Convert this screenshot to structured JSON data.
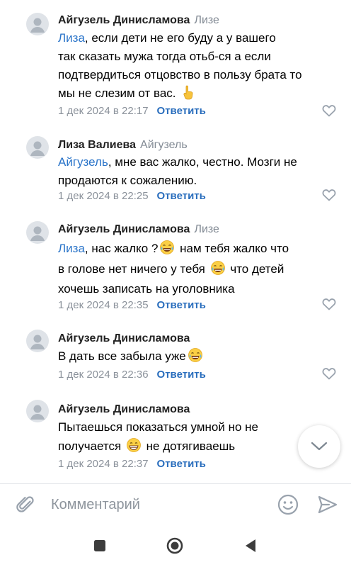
{
  "comments": [
    {
      "author": "Айгузель Динисламова",
      "reply_to": "Лизе",
      "lines": [
        {
          "mention": "Лиза",
          "text": ", если дети не его буду  а у вашего"
        },
        {
          "text": "так сказать мужа тогда отьб-ся  а если"
        },
        {
          "text": "подтвердиться отцовство в пользу брата то"
        },
        {
          "text": "мы не слезим от вас. ",
          "emoji": "pointing-up-emoji"
        }
      ],
      "time": "1 дек 2024 в 22:17",
      "reply_label": "Ответить"
    },
    {
      "author": "Лиза Валиева",
      "reply_to": "Айгузель",
      "lines": [
        {
          "mention": "Айгузель",
          "text": ", мне вас жалко, честно. Мозги не"
        },
        {
          "text": "продаются к сожалению."
        }
      ],
      "time": "1 дек 2024 в 22:25",
      "reply_label": "Ответить"
    },
    {
      "author": "Айгузель Динисламова",
      "reply_to": "Лизе",
      "lines": [
        {
          "mention": "Лиза",
          "text": ", нас жалко ?",
          "emoji": "tears-of-joy-emoji",
          "after": "  нам тебя жалко что"
        },
        {
          "text": "в голове нет ничего у тебя ",
          "emoji": "tears-of-joy-emoji",
          "after": " что детей"
        },
        {
          "text": "хочешь записать на уголовника"
        }
      ],
      "time": "1 дек 2024 в 22:35",
      "reply_label": "Ответить"
    },
    {
      "author": "Айгузель Динисламова",
      "reply_to": "",
      "lines": [
        {
          "text": "В дать все забыла уже",
          "emoji": "tears-of-joy-emoji"
        }
      ],
      "time": "1 дек 2024 в 22:36",
      "reply_label": "Ответить"
    },
    {
      "author": "Айгузель Динисламова",
      "reply_to": "",
      "lines": [
        {
          "text": "Пытаешься показаться умной но не"
        },
        {
          "text": "получается ",
          "emoji": "grinning-emoji",
          "after": " не дотягиваешь"
        }
      ],
      "time": "1 дек 2024 в 22:37",
      "reply_label": "Ответить"
    }
  ],
  "composer": {
    "placeholder": "Комментарий"
  },
  "icons": {
    "attach": "paperclip-icon",
    "emoji_picker": "smile-icon",
    "send": "send-icon",
    "scroll_down": "chevron-down-icon",
    "like": "heart-outline-icon",
    "nav_recents": "square-icon",
    "nav_home": "circle-icon",
    "nav_back": "triangle-back-icon"
  },
  "colors": {
    "mention": "#2a74c9",
    "reply_button": "#2a6ebd",
    "muted": "#8b929b",
    "icon_gray": "#99a2ad"
  }
}
